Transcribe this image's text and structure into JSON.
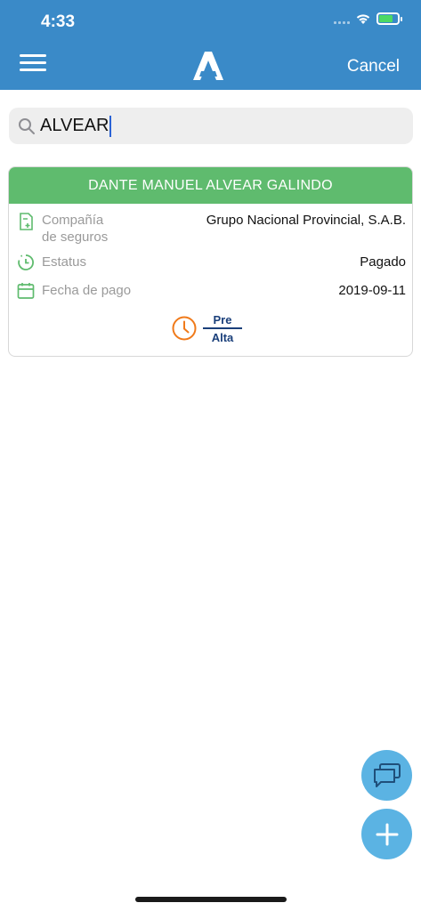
{
  "status_bar": {
    "time": "4:33"
  },
  "header": {
    "cancel_label": "Cancel",
    "brand_color": "#3a8ac8"
  },
  "search": {
    "value": "ALVEAR"
  },
  "result_card": {
    "name": "DANTE MANUEL ALVEAR GALINDO",
    "header_color": "#5fbb6e",
    "rows": [
      {
        "icon": "document-add-icon",
        "label_line1": "Compañía",
        "label_line2": "de seguros",
        "value": "Grupo Nacional Provincial, S.A.B."
      },
      {
        "icon": "clock-history-icon",
        "label": "Estatus",
        "value": "Pagado"
      },
      {
        "icon": "calendar-icon",
        "label": "Fecha de pago",
        "value": "2019-09-11"
      }
    ],
    "badge": {
      "icon": "clock-icon",
      "top": "Pre",
      "bottom": "Alta"
    }
  },
  "fabs": [
    {
      "icon": "chat-icon"
    },
    {
      "icon": "plus-icon"
    }
  ]
}
